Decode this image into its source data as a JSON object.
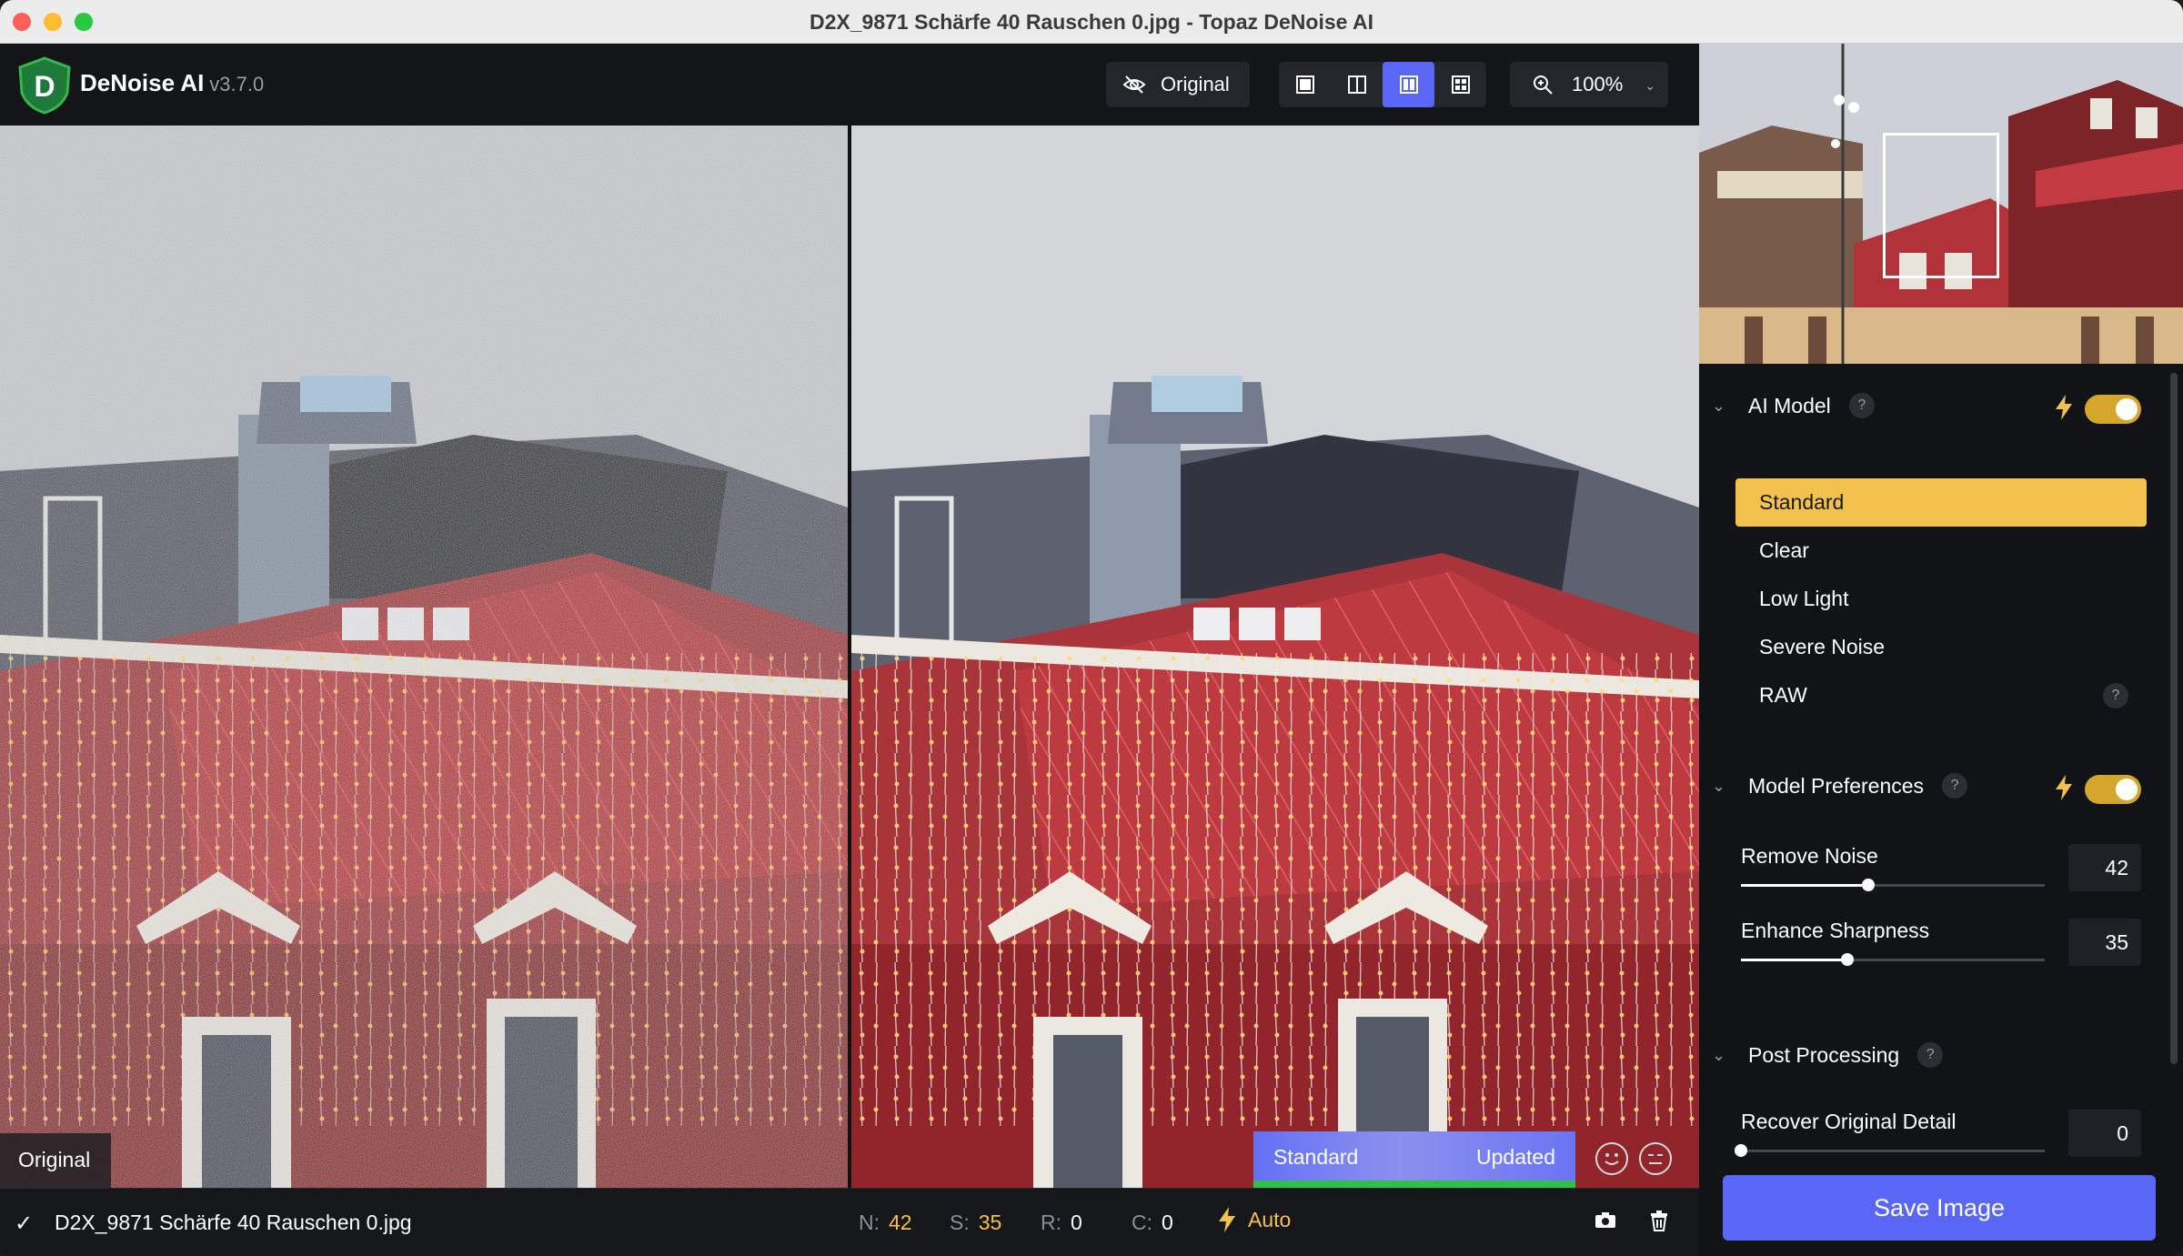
{
  "window": {
    "title": "D2X_9871 Schärfe 40 Rauschen 0.jpg - Topaz DeNoise AI"
  },
  "header": {
    "app_name": "DeNoise AI",
    "app_version": "v3.7.0",
    "original_button": "Original",
    "zoom": "100%"
  },
  "canvas": {
    "left_label": "Original",
    "compare_left": "Standard",
    "compare_right": "Updated"
  },
  "status": {
    "filename": "D2X_9871 Schärfe 40 Rauschen 0.jpg",
    "n_label": "N:",
    "n_value": "42",
    "s_label": "S:",
    "s_value": "35",
    "r_label": "R:",
    "r_value": "0",
    "c_label": "C:",
    "c_value": "0",
    "mode": "Auto"
  },
  "panel": {
    "ai_model": {
      "title": "AI Model",
      "help": "?",
      "enabled": true,
      "models": [
        {
          "label": "Standard",
          "selected": true
        },
        {
          "label": "Clear"
        },
        {
          "label": "Low Light"
        },
        {
          "label": "Severe Noise"
        },
        {
          "label": "RAW",
          "help": "?"
        }
      ]
    },
    "model_preferences": {
      "title": "Model Preferences",
      "help": "?",
      "enabled": true,
      "remove_noise": {
        "label": "Remove Noise",
        "value": "42",
        "fraction": 0.42
      },
      "enhance_sharpness": {
        "label": "Enhance Sharpness",
        "value": "35",
        "fraction": 0.35
      }
    },
    "post_processing": {
      "title": "Post Processing",
      "help": "?",
      "recover_detail": {
        "label": "Recover Original Detail",
        "value": "0",
        "fraction": 0.0
      }
    },
    "save_button": "Save Image"
  },
  "colors": {
    "accent_blue": "#5a66f5",
    "accent_yellow": "#f2c14e",
    "toggle_on": "#d4a72c",
    "progress_green": "#2fbf4a"
  }
}
